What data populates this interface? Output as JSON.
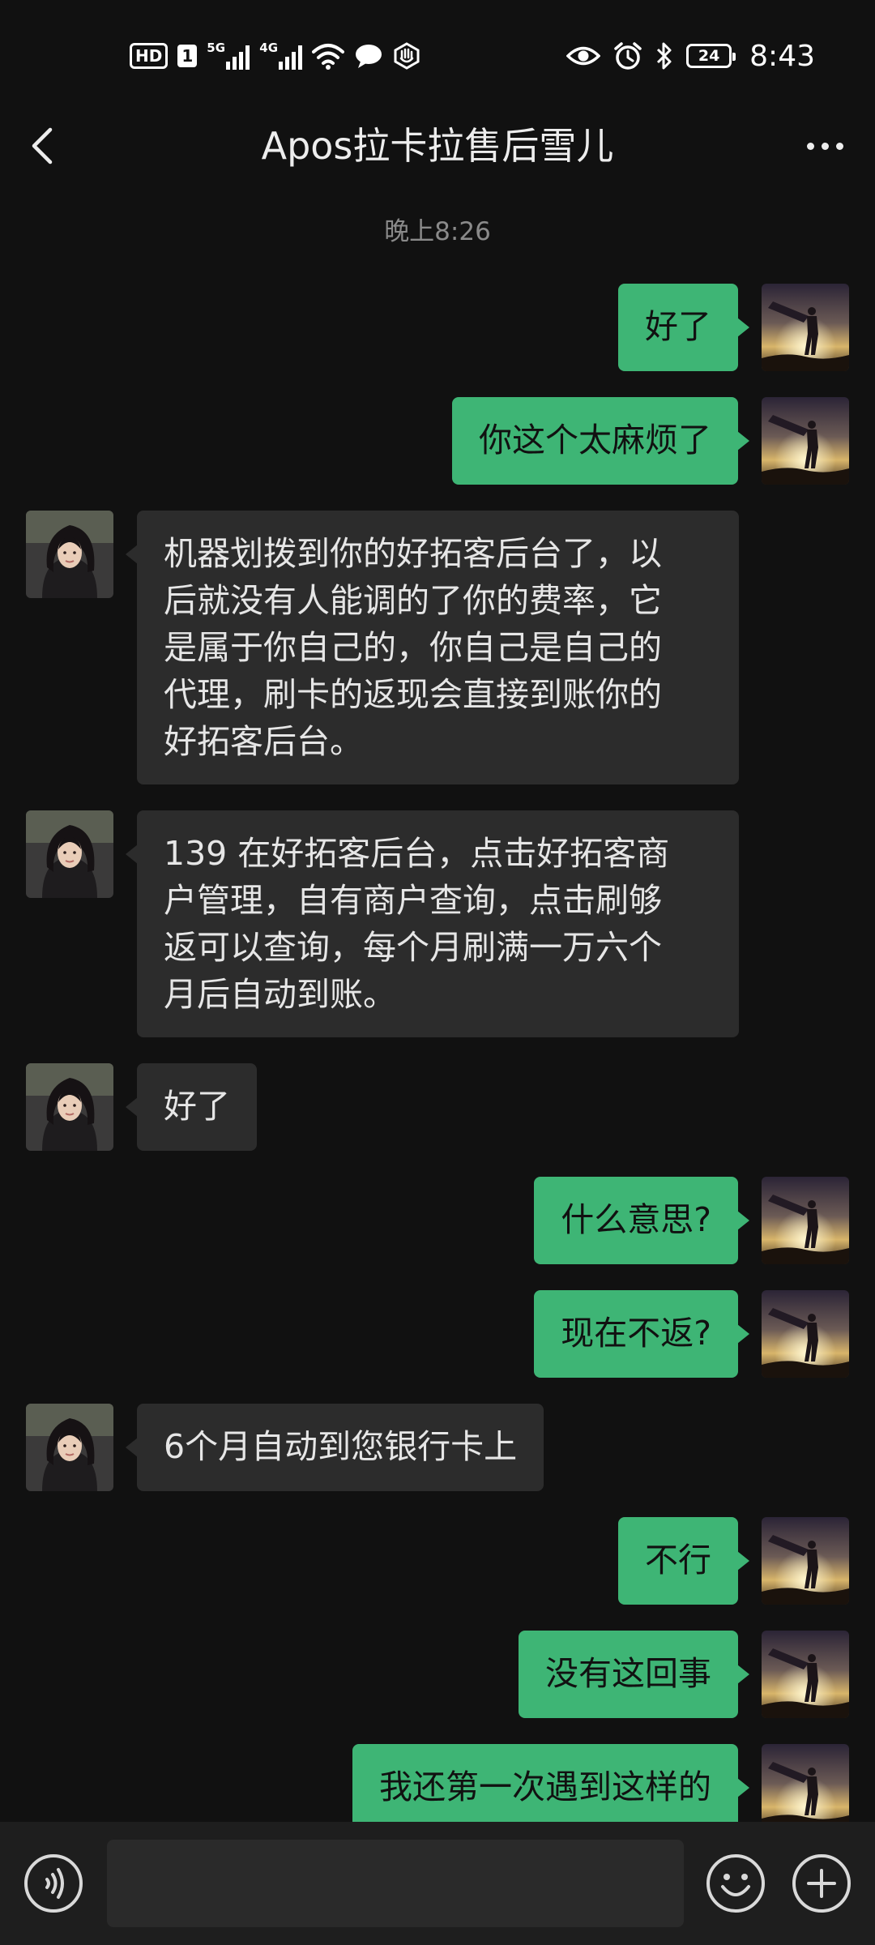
{
  "status_bar": {
    "hd_label": "HD",
    "sim_label": "1",
    "network_1": "5G",
    "network_2": "4G",
    "battery_level": "24",
    "time": "8:43"
  },
  "header": {
    "title": "Apos拉卡拉售后雪儿"
  },
  "chat": {
    "timestamp": "晚上8:26",
    "messages": [
      {
        "from": "me",
        "text": "好了"
      },
      {
        "from": "me",
        "text": "你这个太麻烦了"
      },
      {
        "from": "other",
        "lines": [
          "机器划拨到你的好拓客后台了，以",
          "后就没有人能调的了你的费率，它",
          "是属于你自己的，你自己是自己的",
          "代理，刷卡的返现会直接到账你的",
          "好拓客后台。"
        ]
      },
      {
        "from": "other",
        "lines": [
          "139 在好拓客后台，点击好拓客商",
          "户管理，自有商户查询，点击刷够",
          "返可以查询，每个月刷满一万六个",
          "月后自动到账。"
        ]
      },
      {
        "from": "other",
        "text": "好了"
      },
      {
        "from": "me",
        "text": "什么意思?"
      },
      {
        "from": "me",
        "text": "现在不返?"
      },
      {
        "from": "other",
        "text": "6个月自动到您银行卡上"
      },
      {
        "from": "me",
        "text": "不行"
      },
      {
        "from": "me",
        "text": "没有这回事"
      },
      {
        "from": "me",
        "text": "我还第一次遇到这样的"
      }
    ]
  },
  "input_bar": {
    "placeholder": ""
  },
  "colors": {
    "background": "#111111",
    "outgoing_bubble": "#3eb575",
    "incoming_bubble": "#2c2c2c",
    "input_bar": "#1e1e1e"
  },
  "icons": {
    "back": "back-arrow-icon",
    "more": "more-dots-icon",
    "voice": "voice-icon",
    "emoji": "emoji-icon",
    "plus": "plus-icon"
  }
}
